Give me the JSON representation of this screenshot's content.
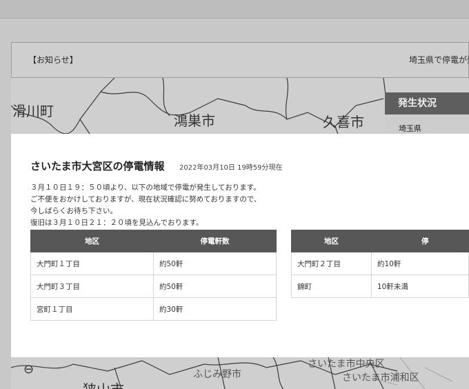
{
  "notice": {
    "label": "【お知らせ】",
    "scroll_text": "埼玉県で停電が発"
  },
  "map_labels": {
    "c1": "滑川町",
    "c2": "鴻巣市",
    "c3": "久喜市",
    "c4": "さいたま市中央区",
    "c5": "ふじみ野市",
    "c6": "さいたま市浦和区",
    "c7": "狭山市"
  },
  "status_panel": {
    "title": "発生状況",
    "region": "埼玉県"
  },
  "modal": {
    "title": "さいたま市大宮区の停電情報",
    "timestamp": "2022年03月10日 19時59分現在",
    "message_lines": [
      "３月１０日１９：５０頃より、以下の地域で停電が発生しております。",
      "ご不便をおかけしておりますが、現在状況確認に努めておりますので、",
      "今しばらくお待ち下さい。",
      "復旧は３月１０日２１：２０頃を見込んでおります。"
    ],
    "table_headers": {
      "area": "地区",
      "count": "停電軒数",
      "count_right_visible": "停"
    },
    "left_rows": [
      {
        "area": "大門町１丁目",
        "count": "約50軒"
      },
      {
        "area": "大門町３丁目",
        "count": "約50軒"
      },
      {
        "area": "宮町１丁目",
        "count": "約30軒"
      }
    ],
    "right_rows": [
      {
        "area": "大門町２丁目",
        "count": "約10軒"
      },
      {
        "area": "錦町",
        "count": "10軒未満"
      }
    ]
  },
  "colors": {
    "header_bg": "#575757",
    "overlay": "#c8c8c8",
    "panel_head": "#5e5e5e"
  }
}
